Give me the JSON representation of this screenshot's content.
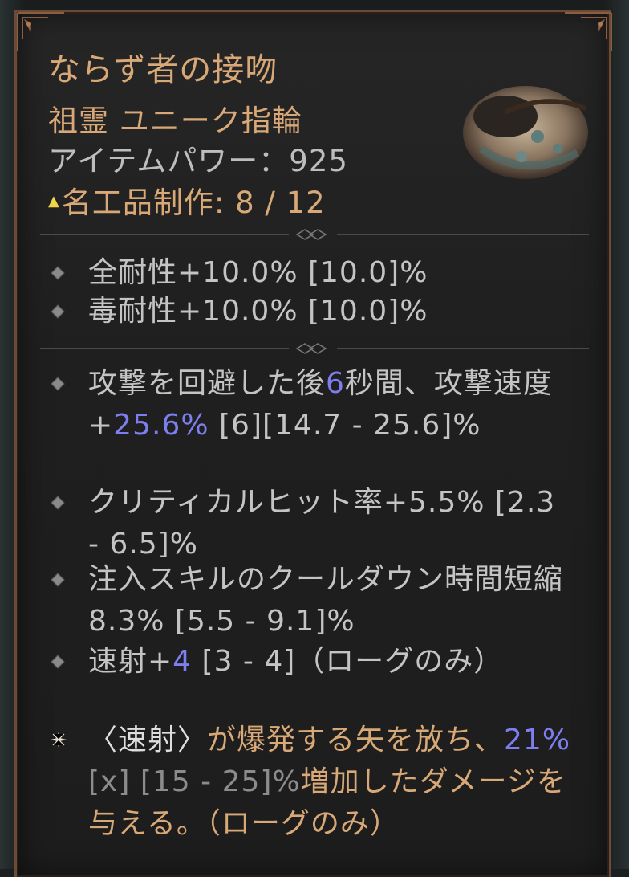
{
  "item": {
    "name": "ならず者の接吻",
    "type": "祖霊 ユニーク指輪",
    "power": "アイテムパワー：925",
    "masterwork_label": "名工品制作: 8 / 12"
  },
  "colors": {
    "title": "#d9a877",
    "highlight": "#7d7ff0",
    "text": "#c4c4c4",
    "range": "#8c8c8c",
    "frame": "#6b4a36"
  },
  "implicits": [
    {
      "text": "全耐性+10.0% [10.0]%"
    },
    {
      "text": "毒耐性+10.0% [10.0]%"
    }
  ],
  "affixes": {
    "a1": {
      "p1": "攻撃を回避した後",
      "v1": "6",
      "p2": "秒間、攻撃速度+",
      "v2": "25.6%",
      "p3": " [6][14.7 - 25.6]%"
    },
    "a2": {
      "text": "クリティカルヒット率+5.5% [2.3 - 6.5]%"
    },
    "a3": {
      "text": "注入スキルのクールダウン時間短縮8.3% [5.5 - 9.1]%"
    },
    "a4": {
      "p1": "速射+",
      "v1": "4",
      "p2": " [3 - 4]（ローグのみ）"
    }
  },
  "unique_power": {
    "p1": "〈速射〉",
    "p2": "が爆発する矢を放ち、",
    "v1": "21%",
    "p3": "[x] [15 - 25]%",
    "p4": "増加したダメージを与える。（ローグのみ）"
  },
  "icons": {
    "masterwork": "triangle-up-icon",
    "bullet": "diamond-bullet-icon",
    "unique": "star-burst-icon",
    "ring": "ring-image"
  }
}
